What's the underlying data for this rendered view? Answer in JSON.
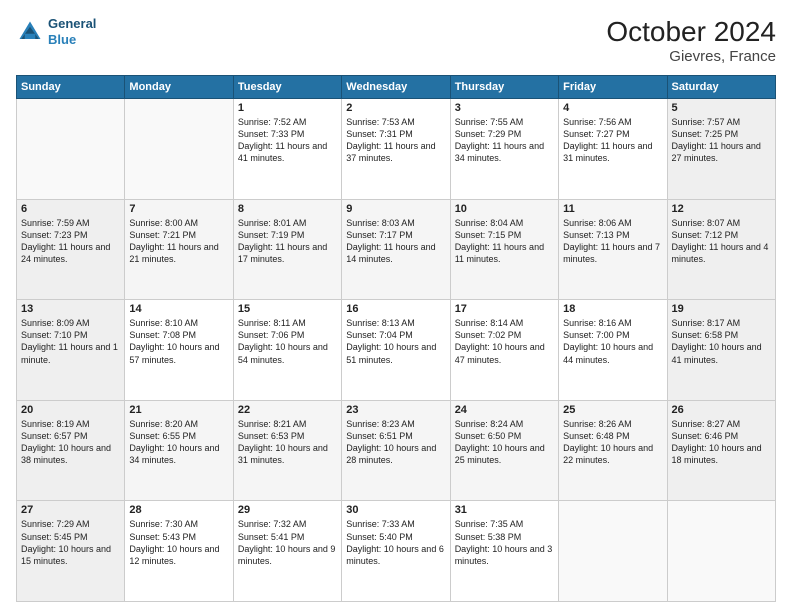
{
  "logo": {
    "line1": "General",
    "line2": "Blue"
  },
  "title": "October 2024",
  "subtitle": "Gievres, France",
  "days_of_week": [
    "Sunday",
    "Monday",
    "Tuesday",
    "Wednesday",
    "Thursday",
    "Friday",
    "Saturday"
  ],
  "weeks": [
    [
      {
        "day": "",
        "sunrise": "",
        "sunset": "",
        "daylight": ""
      },
      {
        "day": "",
        "sunrise": "",
        "sunset": "",
        "daylight": ""
      },
      {
        "day": "1",
        "sunrise": "Sunrise: 7:52 AM",
        "sunset": "Sunset: 7:33 PM",
        "daylight": "Daylight: 11 hours and 41 minutes."
      },
      {
        "day": "2",
        "sunrise": "Sunrise: 7:53 AM",
        "sunset": "Sunset: 7:31 PM",
        "daylight": "Daylight: 11 hours and 37 minutes."
      },
      {
        "day": "3",
        "sunrise": "Sunrise: 7:55 AM",
        "sunset": "Sunset: 7:29 PM",
        "daylight": "Daylight: 11 hours and 34 minutes."
      },
      {
        "day": "4",
        "sunrise": "Sunrise: 7:56 AM",
        "sunset": "Sunset: 7:27 PM",
        "daylight": "Daylight: 11 hours and 31 minutes."
      },
      {
        "day": "5",
        "sunrise": "Sunrise: 7:57 AM",
        "sunset": "Sunset: 7:25 PM",
        "daylight": "Daylight: 11 hours and 27 minutes."
      }
    ],
    [
      {
        "day": "6",
        "sunrise": "Sunrise: 7:59 AM",
        "sunset": "Sunset: 7:23 PM",
        "daylight": "Daylight: 11 hours and 24 minutes."
      },
      {
        "day": "7",
        "sunrise": "Sunrise: 8:00 AM",
        "sunset": "Sunset: 7:21 PM",
        "daylight": "Daylight: 11 hours and 21 minutes."
      },
      {
        "day": "8",
        "sunrise": "Sunrise: 8:01 AM",
        "sunset": "Sunset: 7:19 PM",
        "daylight": "Daylight: 11 hours and 17 minutes."
      },
      {
        "day": "9",
        "sunrise": "Sunrise: 8:03 AM",
        "sunset": "Sunset: 7:17 PM",
        "daylight": "Daylight: 11 hours and 14 minutes."
      },
      {
        "day": "10",
        "sunrise": "Sunrise: 8:04 AM",
        "sunset": "Sunset: 7:15 PM",
        "daylight": "Daylight: 11 hours and 11 minutes."
      },
      {
        "day": "11",
        "sunrise": "Sunrise: 8:06 AM",
        "sunset": "Sunset: 7:13 PM",
        "daylight": "Daylight: 11 hours and 7 minutes."
      },
      {
        "day": "12",
        "sunrise": "Sunrise: 8:07 AM",
        "sunset": "Sunset: 7:12 PM",
        "daylight": "Daylight: 11 hours and 4 minutes."
      }
    ],
    [
      {
        "day": "13",
        "sunrise": "Sunrise: 8:09 AM",
        "sunset": "Sunset: 7:10 PM",
        "daylight": "Daylight: 11 hours and 1 minute."
      },
      {
        "day": "14",
        "sunrise": "Sunrise: 8:10 AM",
        "sunset": "Sunset: 7:08 PM",
        "daylight": "Daylight: 10 hours and 57 minutes."
      },
      {
        "day": "15",
        "sunrise": "Sunrise: 8:11 AM",
        "sunset": "Sunset: 7:06 PM",
        "daylight": "Daylight: 10 hours and 54 minutes."
      },
      {
        "day": "16",
        "sunrise": "Sunrise: 8:13 AM",
        "sunset": "Sunset: 7:04 PM",
        "daylight": "Daylight: 10 hours and 51 minutes."
      },
      {
        "day": "17",
        "sunrise": "Sunrise: 8:14 AM",
        "sunset": "Sunset: 7:02 PM",
        "daylight": "Daylight: 10 hours and 47 minutes."
      },
      {
        "day": "18",
        "sunrise": "Sunrise: 8:16 AM",
        "sunset": "Sunset: 7:00 PM",
        "daylight": "Daylight: 10 hours and 44 minutes."
      },
      {
        "day": "19",
        "sunrise": "Sunrise: 8:17 AM",
        "sunset": "Sunset: 6:58 PM",
        "daylight": "Daylight: 10 hours and 41 minutes."
      }
    ],
    [
      {
        "day": "20",
        "sunrise": "Sunrise: 8:19 AM",
        "sunset": "Sunset: 6:57 PM",
        "daylight": "Daylight: 10 hours and 38 minutes."
      },
      {
        "day": "21",
        "sunrise": "Sunrise: 8:20 AM",
        "sunset": "Sunset: 6:55 PM",
        "daylight": "Daylight: 10 hours and 34 minutes."
      },
      {
        "day": "22",
        "sunrise": "Sunrise: 8:21 AM",
        "sunset": "Sunset: 6:53 PM",
        "daylight": "Daylight: 10 hours and 31 minutes."
      },
      {
        "day": "23",
        "sunrise": "Sunrise: 8:23 AM",
        "sunset": "Sunset: 6:51 PM",
        "daylight": "Daylight: 10 hours and 28 minutes."
      },
      {
        "day": "24",
        "sunrise": "Sunrise: 8:24 AM",
        "sunset": "Sunset: 6:50 PM",
        "daylight": "Daylight: 10 hours and 25 minutes."
      },
      {
        "day": "25",
        "sunrise": "Sunrise: 8:26 AM",
        "sunset": "Sunset: 6:48 PM",
        "daylight": "Daylight: 10 hours and 22 minutes."
      },
      {
        "day": "26",
        "sunrise": "Sunrise: 8:27 AM",
        "sunset": "Sunset: 6:46 PM",
        "daylight": "Daylight: 10 hours and 18 minutes."
      }
    ],
    [
      {
        "day": "27",
        "sunrise": "Sunrise: 7:29 AM",
        "sunset": "Sunset: 5:45 PM",
        "daylight": "Daylight: 10 hours and 15 minutes."
      },
      {
        "day": "28",
        "sunrise": "Sunrise: 7:30 AM",
        "sunset": "Sunset: 5:43 PM",
        "daylight": "Daylight: 10 hours and 12 minutes."
      },
      {
        "day": "29",
        "sunrise": "Sunrise: 7:32 AM",
        "sunset": "Sunset: 5:41 PM",
        "daylight": "Daylight: 10 hours and 9 minutes."
      },
      {
        "day": "30",
        "sunrise": "Sunrise: 7:33 AM",
        "sunset": "Sunset: 5:40 PM",
        "daylight": "Daylight: 10 hours and 6 minutes."
      },
      {
        "day": "31",
        "sunrise": "Sunrise: 7:35 AM",
        "sunset": "Sunset: 5:38 PM",
        "daylight": "Daylight: 10 hours and 3 minutes."
      },
      {
        "day": "",
        "sunrise": "",
        "sunset": "",
        "daylight": ""
      },
      {
        "day": "",
        "sunrise": "",
        "sunset": "",
        "daylight": ""
      }
    ]
  ]
}
